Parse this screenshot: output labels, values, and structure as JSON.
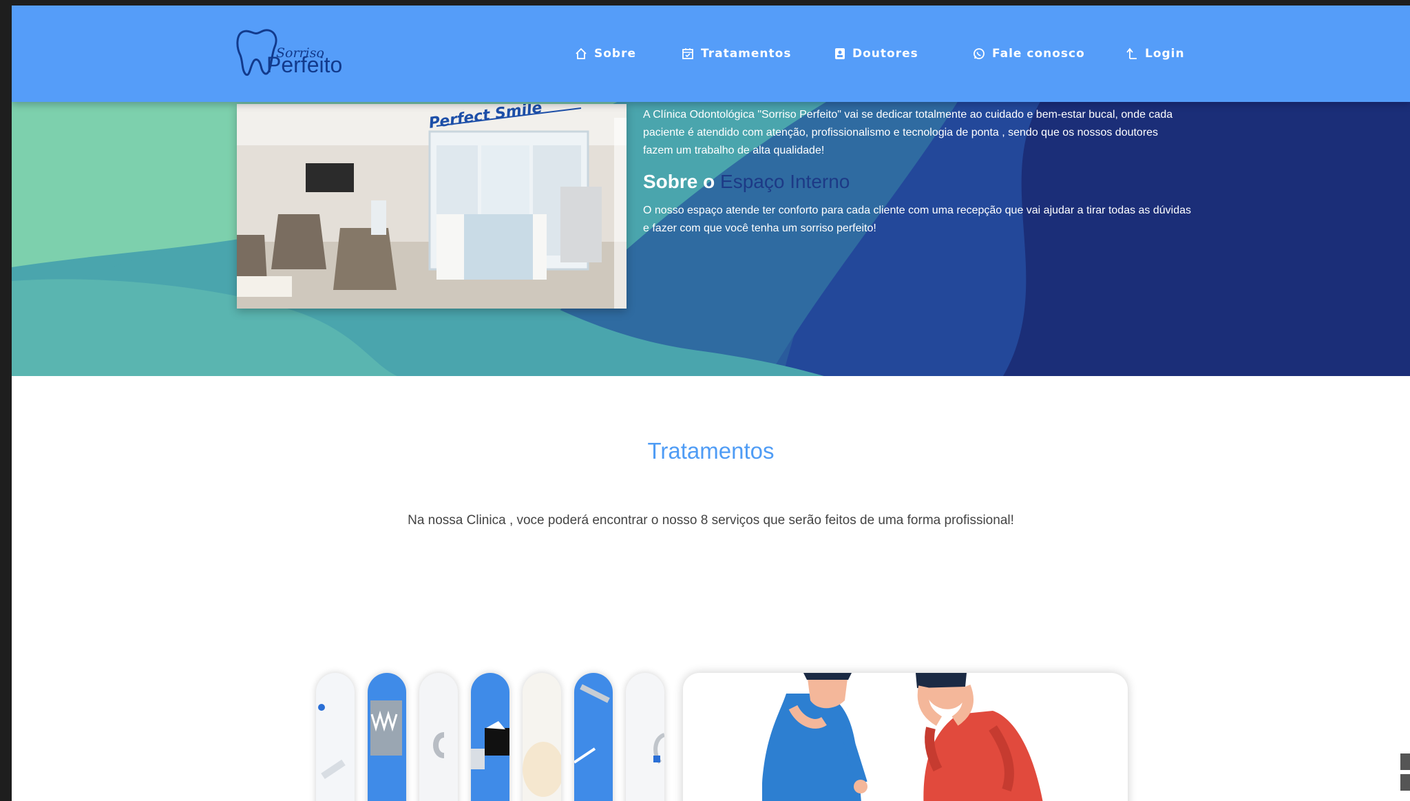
{
  "brand": {
    "logo_script": "Sorriso",
    "logo_main": "Perfeito"
  },
  "nav": {
    "items": [
      {
        "label": "Sobre",
        "icon": "home-icon"
      },
      {
        "label": "Tratamentos",
        "icon": "calendar-icon"
      },
      {
        "label": "Doutores",
        "icon": "badge-icon"
      },
      {
        "label": "Fale conosco",
        "icon": "whatsapp-icon"
      },
      {
        "label": "Login",
        "icon": "login-arrow-icon"
      }
    ]
  },
  "hero": {
    "photo_sign": "Perfect Smile",
    "intro": "A Clínica Odontológica \"Sorriso Perfeito\" vai se dedicar totalmente ao cuidado e bem-estar bucal, onde cada paciente é atendido com atenção, profissionalismo e tecnologia de ponta , sendo que os nossos doutores fazem um trabalho de alta qualidade!",
    "heading_prefix": "Sobre o",
    "heading_accent": "Espaço Interno",
    "space_text": "O nosso espaço atende ter conforto para cada cliente com uma recepção que vai ajudar a tirar todas as dúvidas e fazer com que você tenha um sorriso perfeito!"
  },
  "treatments": {
    "title": "Tratamentos",
    "description": "Na nossa Clinica , voce poderá encontrar o nosso 8 serviços que serão feitos de uma forma profissional!"
  },
  "colors": {
    "navbar": "#559df9",
    "wave_green": "#7dd0ad",
    "wave_teal": "#4aa5ad",
    "wave_blue": "#2a5b9c",
    "wave_navy": "#1b2e78",
    "title_blue": "#4f9cf5",
    "accent_navy": "#1d3a86"
  }
}
